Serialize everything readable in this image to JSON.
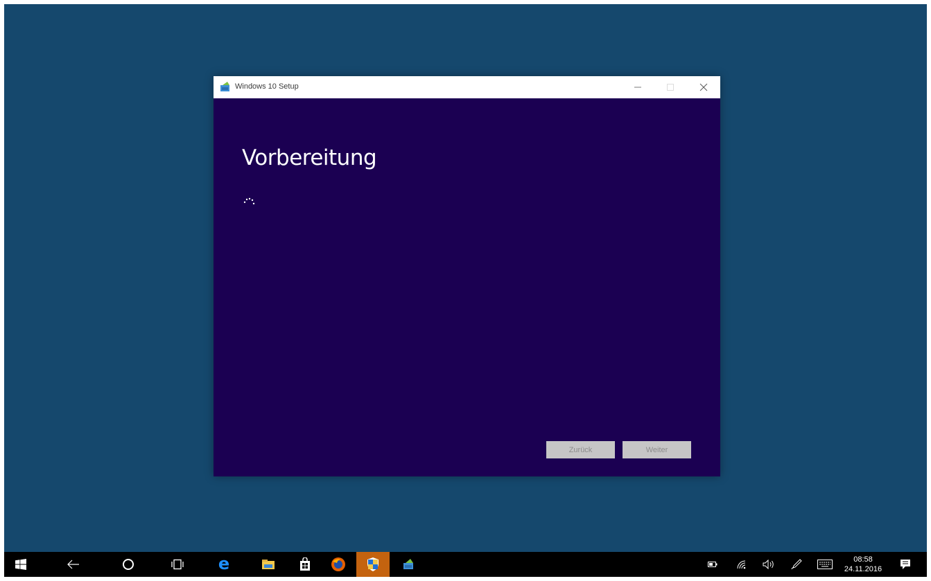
{
  "window": {
    "title": "Windows 10 Setup",
    "heading": "Vorbereitung",
    "back_label": "Zurück",
    "next_label": "Weiter"
  },
  "taskbar": {
    "items": [
      "start-icon",
      "back-arrow-icon",
      "cortana-icon",
      "task-view-icon",
      "edge-icon",
      "file-explorer-icon",
      "store-icon",
      "firefox-icon",
      "security-shield-icon",
      "windows-setup-icon"
    ],
    "active_item": "security-shield-icon"
  },
  "tray": {
    "icons": [
      "battery-icon",
      "wifi-icon",
      "volume-icon",
      "pen-icon",
      "keyboard-icon",
      "notifications-icon"
    ],
    "time": "08:58",
    "date": "24.11.2016"
  },
  "colors": {
    "desktop": "#15486d",
    "window_bg": "#1b0052",
    "taskbar": "#000000",
    "active_taskbar_item": "#c4630f"
  }
}
